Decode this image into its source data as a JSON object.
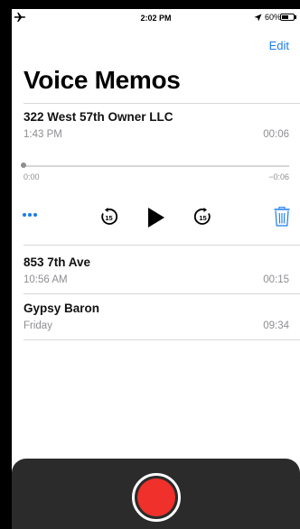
{
  "status_bar": {
    "time": "2:02 PM",
    "battery": "60%",
    "battery_level": 0.6,
    "icons": [
      "airplane-icon",
      "location-icon",
      "battery-icon"
    ]
  },
  "header": {
    "edit_label": "Edit",
    "title": "Voice Memos"
  },
  "memos": [
    {
      "name": "322 West 57th Owner LLC",
      "date": "1:43 PM",
      "duration": "00:06",
      "expanded": true,
      "scrub_start": "0:00",
      "scrub_end": "−0:06",
      "progress": 0
    },
    {
      "name": "853 7th Ave",
      "date": "10:56 AM",
      "duration": "00:15"
    },
    {
      "name": "Gypsy Baron",
      "date": "Friday",
      "duration": "09:34"
    }
  ],
  "controls": {
    "more": "more-icon",
    "skip_back": "skip-back-15-icon",
    "play": "play-icon",
    "skip_forward": "skip-forward-15-icon",
    "delete": "trash-icon"
  },
  "colors": {
    "accent": "#1a7cf0",
    "record": "#f0302a",
    "panel": "#2b2b2b"
  }
}
